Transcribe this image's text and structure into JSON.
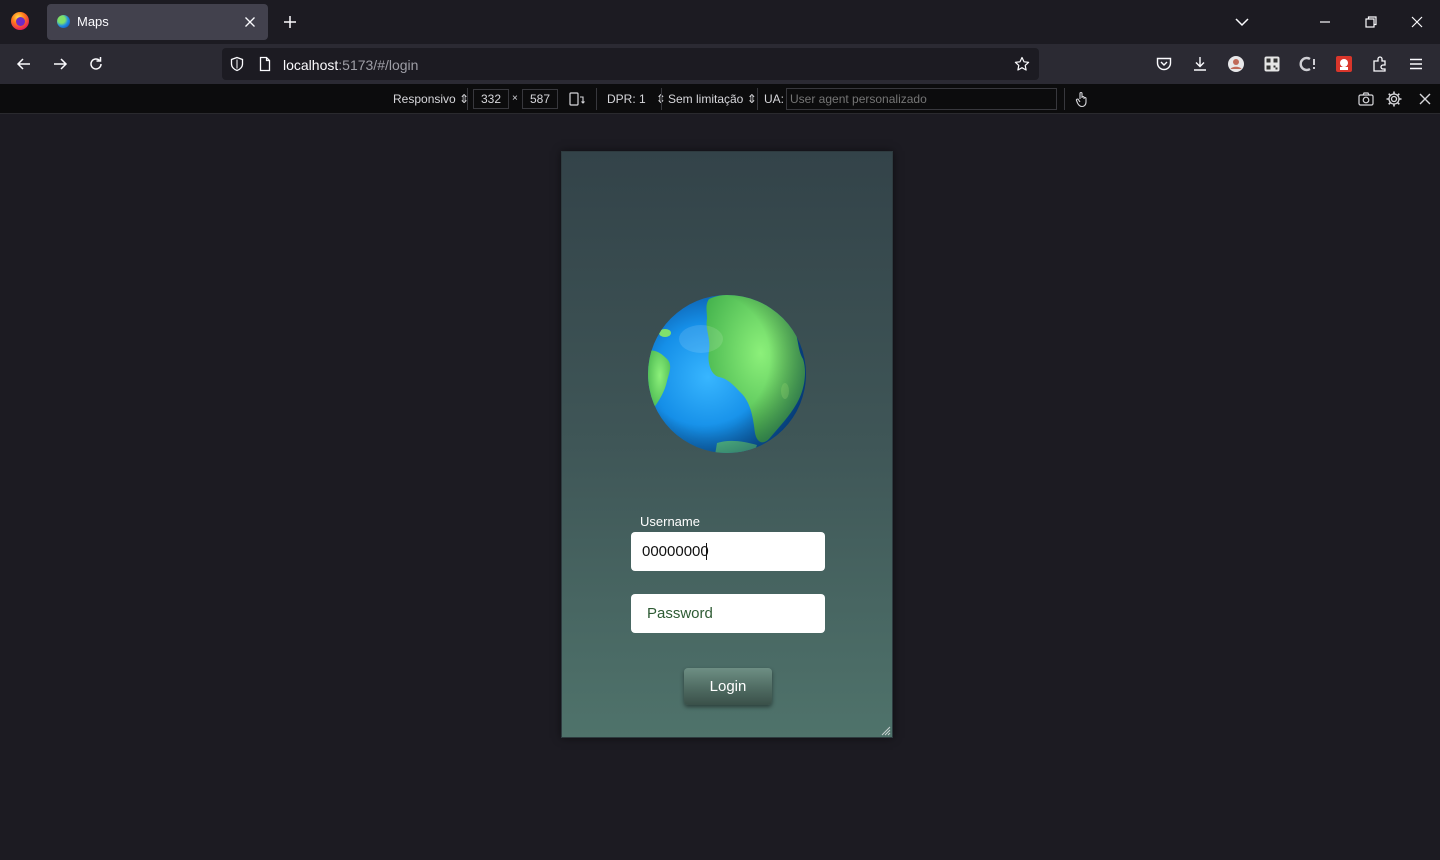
{
  "browser": {
    "tab": {
      "title": "Maps"
    },
    "url": {
      "host": "localhost",
      "path": ":5173/#/login"
    }
  },
  "devtools_responsive": {
    "device_select": "Responsivo",
    "width": "332",
    "times": "×",
    "height": "587",
    "dpr": "DPR: 1",
    "throttle": "Sem limitação",
    "ua_label": "UA:",
    "ua_placeholder": "User agent personalizado"
  },
  "login": {
    "username_label": "Username",
    "username_value": "00000000",
    "password_placeholder": "Password",
    "button_label": "Login"
  },
  "icons": {
    "browser_logo": "firefox-icon",
    "globe": "globe-icon"
  }
}
